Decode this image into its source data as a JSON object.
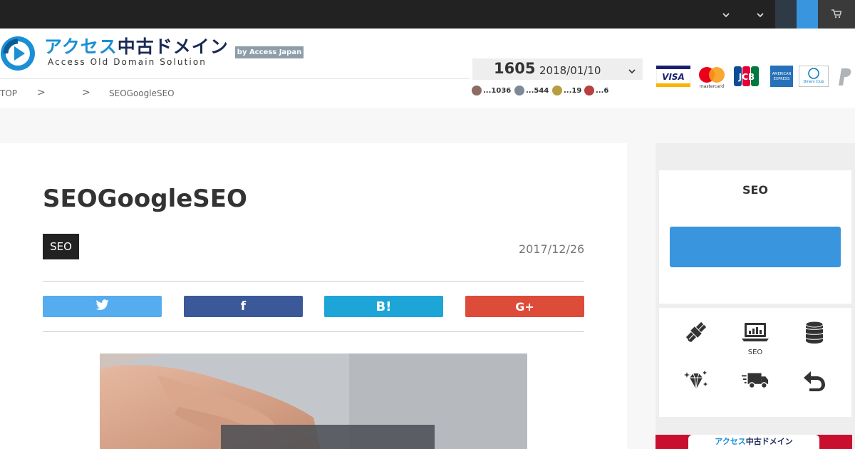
{
  "site": {
    "logo_jp_blue": "アクセス",
    "logo_jp_dark": "中古ドメイン",
    "logo_en": "Access Old Domain Solution",
    "badge": "by Access Japan"
  },
  "topbar": {
    "icons": [
      "chevron-down-icon",
      "chevron-down-icon",
      "cart-icon"
    ],
    "colors": {
      "bar": "#222222",
      "accent": "#3895de"
    }
  },
  "breadcrumb": {
    "top": "TOP",
    "sep1": ">",
    "sep2": ">",
    "current": "SEOGoogleSEO"
  },
  "stock": {
    "count": "1605",
    "date": "2018/01/10",
    "counts": [
      {
        "text": "...1036",
        "color": "#8c6b60"
      },
      {
        "text": "...544",
        "color": "#7d8a96"
      },
      {
        "text": "...19",
        "color": "#b79d42"
      },
      {
        "text": "...6",
        "color": "#b84040"
      }
    ]
  },
  "payment_cards": [
    "VISA",
    "mastercard",
    "JCB",
    "AMERICAN EXPRESS",
    "Diners Club INTERNATIONAL",
    "PayPal"
  ],
  "article": {
    "title": "SEOGoogleSEO",
    "category": "SEO",
    "date": "2017/12/26",
    "share": {
      "twitter": "",
      "facebook": "f",
      "hatena": "B!",
      "google_plus": "G+"
    }
  },
  "sidebar": {
    "box_title": "SEO",
    "icons": [
      {
        "name": "satellite-icon",
        "label": ""
      },
      {
        "name": "laptop-chart-icon",
        "label": "SEO"
      },
      {
        "name": "coins-icon",
        "label": ""
      },
      {
        "name": "diamond-icon",
        "label": ""
      },
      {
        "name": "truck-icon",
        "label": ""
      },
      {
        "name": "return-icon",
        "label": ""
      }
    ],
    "banner_blue": "アクセス",
    "banner_dark": "中古ドメイン"
  }
}
